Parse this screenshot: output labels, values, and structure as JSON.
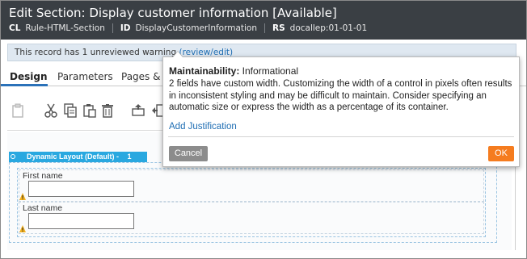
{
  "header": {
    "title": "Edit  Section: Display customer information [Available]",
    "meta": [
      {
        "key": "CL",
        "value": "Rule-HTML-Section"
      },
      {
        "key": "ID",
        "value": "DisplayCustomerInformation"
      },
      {
        "key": "RS",
        "value": "docallep:01-01-01"
      }
    ]
  },
  "warning_bar": {
    "text": "This record has 1 unreviewed warning",
    "link": "(review/edit)"
  },
  "tabs": [
    {
      "label": "Design",
      "active": true
    },
    {
      "label": "Parameters",
      "active": false
    },
    {
      "label": "Pages & C",
      "active": false
    }
  ],
  "toolbar": {
    "icons": [
      "clipboard-icon",
      "cut-icon",
      "copy-icon",
      "paste-icon",
      "delete-icon",
      "insert-row-icon",
      "insert-column-icon"
    ]
  },
  "layout": {
    "header": "Dynamic Layout (Default) -",
    "number": "1",
    "fields": [
      {
        "label": "First name",
        "value": ""
      },
      {
        "label": "Last name",
        "value": ""
      }
    ]
  },
  "popover": {
    "heading_bold": "Maintainability:",
    "heading_rest": " Informational",
    "message": "2 fields have custom width. Customizing the width of a control in pixels often results in inconsistent styling and may be difficult to maintain.  Consider specifying an automatic size or express the width as  a percentage of its container.",
    "link": "Add Justification",
    "cancel_label": "Cancel",
    "ok_label": "OK"
  },
  "colors": {
    "header_bg": "#3a3f44",
    "accent_blue": "#29a8e0",
    "link_blue": "#1e6db3",
    "ok_orange": "#f57c1f",
    "cancel_gray": "#8c8c8c",
    "warning_yellow": "#f2b01e"
  }
}
